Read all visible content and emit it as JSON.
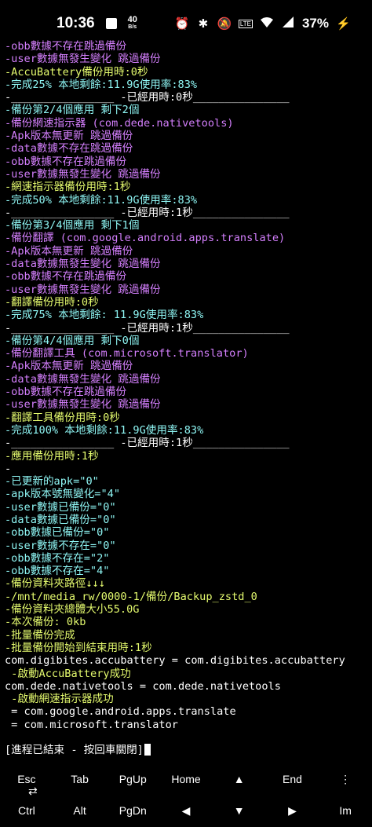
{
  "status_bar": {
    "time": "10:36",
    "net_speed": "40",
    "net_unit": "B/s",
    "battery": "37%",
    "lte_label": "LTE",
    "icons": [
      "alarm-icon",
      "bluetooth-icon",
      "mute-icon",
      "lte-icon",
      "wifi-icon",
      "signal-icon",
      "battery-icon"
    ]
  },
  "terminal": {
    "lines": [
      {
        "text": "-obb數據不存在跳過備份",
        "color": "purple"
      },
      {
        "text": "-user數據無發生變化 跳過備份",
        "color": "purple"
      },
      {
        "text": "-AccuBattery備份用時:0秒",
        "color": "yellow"
      },
      {
        "text": "-完成25% 本地剩餘:11.9G使用率:83%",
        "color": "cyan"
      },
      {
        "text": "-________________ -已經用時:0秒_______________",
        "color": "white"
      },
      {
        "text": "-備份第2/4個應用 剩下2個",
        "color": "cyan"
      },
      {
        "text": "-備份網速指示器 (com.dede.nativetools)",
        "color": "purple"
      },
      {
        "text": "-Apk版本無更新 跳過備份",
        "color": "purple"
      },
      {
        "text": "-data數據不存在跳過備份",
        "color": "purple"
      },
      {
        "text": "-obb數據不存在跳過備份",
        "color": "purple"
      },
      {
        "text": "-user數據無發生變化 跳過備份",
        "color": "purple"
      },
      {
        "text": "-網速指示器備份用時:1秒",
        "color": "yellow"
      },
      {
        "text": "-完成50% 本地剩餘:11.9G使用率:83%",
        "color": "cyan"
      },
      {
        "text": "-________________ -已經用時:1秒_______________",
        "color": "white"
      },
      {
        "text": "-備份第3/4個應用 剩下1個",
        "color": "cyan"
      },
      {
        "text": "-備份翻譯 (com.google.android.apps.translate)",
        "color": "purple"
      },
      {
        "text": "-Apk版本無更新 跳過備份",
        "color": "purple"
      },
      {
        "text": "-data數據無發生變化 跳過備份",
        "color": "purple"
      },
      {
        "text": "-obb數據不存在跳過備份",
        "color": "purple"
      },
      {
        "text": "-user數據無發生變化 跳過備份",
        "color": "purple"
      },
      {
        "text": "-翻譯備份用時:0秒",
        "color": "yellow"
      },
      {
        "text": "-完成75% 本地剩餘: 11.9G使用率:83%",
        "color": "cyan"
      },
      {
        "text": "-________________ -已經用時:1秒_______________",
        "color": "white"
      },
      {
        "text": "-備份第4/4個應用 剩下0個",
        "color": "cyan"
      },
      {
        "text": "-備份翻譯工具 (com.microsoft.translator)",
        "color": "purple"
      },
      {
        "text": "-Apk版本無更新 跳過備份",
        "color": "purple"
      },
      {
        "text": "-data數據無發生變化 跳過備份",
        "color": "purple"
      },
      {
        "text": "-obb數據不存在跳過備份",
        "color": "purple"
      },
      {
        "text": "-user數據無發生變化 跳過備份",
        "color": "purple"
      },
      {
        "text": "-翻譯工具備份用時:0秒",
        "color": "yellow"
      },
      {
        "text": "-完成100% 本地剩餘:11.9G使用率:83%",
        "color": "cyan"
      },
      {
        "text": "-________________ -已經用時:1秒_______________",
        "color": "white"
      },
      {
        "text": "-應用備份用時:1秒",
        "color": "yellow"
      },
      {
        "text": "-",
        "color": "white"
      },
      {
        "text": "-已更新的apk=\"0\"",
        "color": "cyan"
      },
      {
        "text": "-apk版本號無變化=\"4\"",
        "color": "cyan"
      },
      {
        "text": "-user數據已備份=\"0\"",
        "color": "cyan"
      },
      {
        "text": "-data數據已備份=\"0\"",
        "color": "cyan"
      },
      {
        "text": "-obb數據已備份=\"0\"",
        "color": "cyan"
      },
      {
        "text": "-user數據不存在=\"0\"",
        "color": "cyan"
      },
      {
        "text": "-obb數據不存在=\"2\"",
        "color": "cyan"
      },
      {
        "text": "-obb數據不存在=\"4\"",
        "color": "cyan"
      },
      {
        "text": "-備份資料夾路徑↓↓↓",
        "color": "yellow"
      },
      {
        "text": "-/mnt/media_rw/0000-1/備份/Backup_zstd_0",
        "color": "yellow"
      },
      {
        "text": "-備份資料夾總體大小55.0G",
        "color": "yellow"
      },
      {
        "text": "-本次備份: 0kb",
        "color": "yellow"
      },
      {
        "text": "-批量備份完成",
        "color": "yellow"
      },
      {
        "text": "-批量備份開始到結束用時:1秒",
        "color": "yellow"
      },
      {
        "text": "com.digibites.accubattery = com.digibites.accubattery",
        "color": "white"
      },
      {
        "text": " -啟動AccuBattery成功",
        "color": "yellow"
      },
      {
        "text": "com.dede.nativetools = com.dede.nativetools",
        "color": "white"
      },
      {
        "text": " -啟動網速指示器成功",
        "color": "yellow"
      },
      {
        "text": " = com.google.android.apps.translate",
        "color": "white"
      },
      {
        "text": " = com.microsoft.translator",
        "color": "white"
      },
      {
        "text": "",
        "color": "white"
      },
      {
        "text": "[進程已結束 - 按回車關閉]",
        "color": "white"
      }
    ]
  },
  "extra_keys": {
    "row1": [
      "Esc",
      "Tab",
      "PgUp",
      "Home",
      "▲",
      "End",
      "⋮"
    ],
    "row2": [
      "Ctrl",
      "Alt",
      "PgDn",
      "◀",
      "▼",
      "▶",
      "Im"
    ]
  }
}
